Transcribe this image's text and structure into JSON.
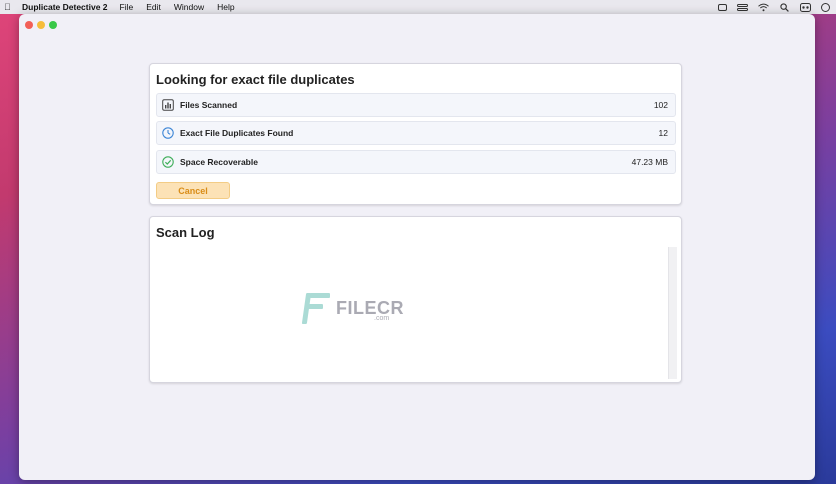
{
  "menubar": {
    "app_name": "Duplicate Detective 2",
    "items": [
      "File",
      "Edit",
      "Window",
      "Help"
    ],
    "right_icons": [
      "screen-mirroring-icon",
      "control-center-icon",
      "wifi-icon",
      "search-icon",
      "user-switch-icon",
      "siri-icon"
    ]
  },
  "scan": {
    "title": "Looking for exact file duplicates",
    "stats": [
      {
        "label": "Files Scanned",
        "value": "102",
        "icon": "bar-chart-icon"
      },
      {
        "label": "Exact File Duplicates Found",
        "value": "12",
        "icon": "clock-icon"
      },
      {
        "label": "Space Recoverable",
        "value": "47.23 MB",
        "icon": "checkmark-circle-icon"
      }
    ],
    "cancel_label": "Cancel"
  },
  "log": {
    "title": "Scan Log"
  },
  "watermark": {
    "text": "FILECR",
    "sub": ".com"
  },
  "colors": {
    "cancel_bg": "#fce2b6",
    "cancel_text": "#d98d18",
    "clock_icon": "#3d86d6",
    "check_icon": "#3fae5a"
  }
}
